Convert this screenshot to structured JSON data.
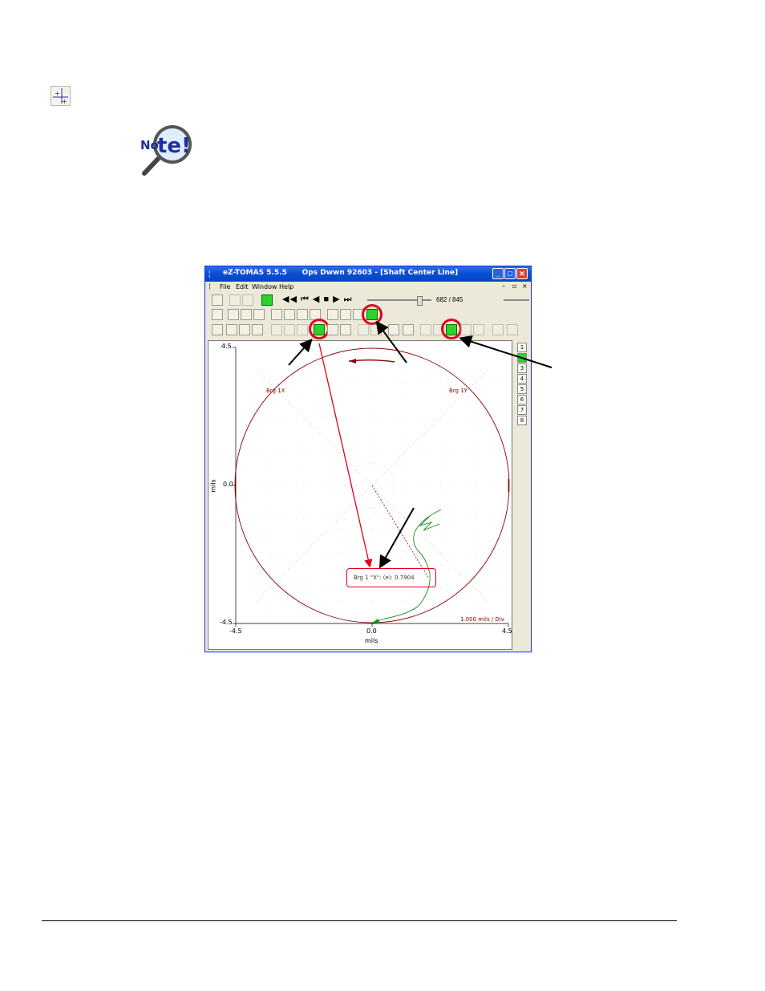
{
  "window": {
    "title": "eZ-TOMAS 5.5.5      Ops Dwwn 92603 - [Shaft Center Line]",
    "menu": [
      "File",
      "Edit",
      "Window",
      "Help"
    ],
    "counter": "682 / 845"
  },
  "note_icon": {
    "text": "Note!"
  },
  "plot": {
    "y_top": "4.5",
    "y_mid": "0.0",
    "y_bot": "-4.5",
    "x_left": "-4.5",
    "x_mid": "0.0",
    "x_right": "4.5",
    "xlabel": "mils",
    "ylabel": "mils",
    "label_x": "Brg 1X",
    "label_y": "Brg 1Y",
    "scale": "1.000 mils / Div",
    "readout": "Brg 1 \"X\": (e): 0.7904"
  },
  "channels": [
    "1",
    "2",
    "3",
    "4",
    "5",
    "6",
    "7",
    "8"
  ],
  "active_channel": "2",
  "colors": {
    "accent_red": "#e0001a",
    "toolbar_green": "#2bd32b",
    "orbit_red": "#8b0000",
    "trace_green": "#1a8a1a"
  }
}
